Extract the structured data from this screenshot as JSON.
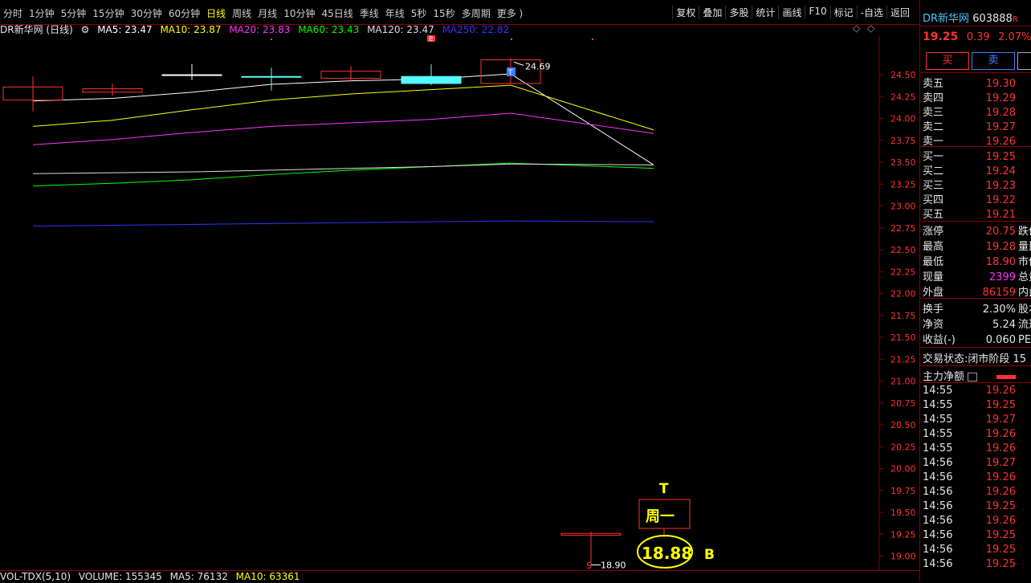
{
  "toolbar": {
    "tabs": [
      "分时",
      "1分钟",
      "5分钟",
      "15分钟",
      "30分钟",
      "60分钟",
      "日线",
      "周线",
      "月线",
      "10分钟",
      "45日线",
      "季线",
      "年线",
      "5秒",
      "15秒",
      "多周期",
      "更多 )"
    ],
    "active_tab": "日线",
    "right_buttons": [
      "复权",
      "叠加",
      "多股",
      "统计",
      "画线",
      "F10",
      "标记",
      "-自选",
      "返回"
    ]
  },
  "chart_header": {
    "name": "DR新华网 (日线)",
    "ma5": "MA5: 23.47",
    "ma10": "MA10: 23.87",
    "ma20": "MA20: 23.83",
    "ma60": "MA60: 23.43",
    "ma120": "MA120: 23.47",
    "ma250": "MA250: 22.82"
  },
  "colors": {
    "ma5": "#ffffff",
    "ma10": "#ffff00",
    "ma20": "#ff33ff",
    "ma60": "#00ff00",
    "ma120": "#dddddd",
    "ma250": "#3333ff",
    "up": "#ff3333",
    "down": "#54ffff",
    "grid": "#8a0000"
  },
  "chart_data": {
    "type": "candlestick",
    "yticks": [
      "24.50",
      "24.25",
      "24.00",
      "23.75",
      "23.50",
      "23.25",
      "23.00",
      "22.75",
      "22.50",
      "22.25",
      "22.00",
      "21.75",
      "21.50",
      "21.25",
      "21.00",
      "20.75",
      "20.50",
      "20.25",
      "20.00",
      "19.75",
      "19.50",
      "19.25",
      "19.00"
    ],
    "ylim": [
      18.84,
      24.95
    ],
    "candles": [
      {
        "open": 24.21,
        "close": 24.36,
        "high": 24.48,
        "low": 24.08,
        "color": "up"
      },
      {
        "open": 24.3,
        "close": 24.34,
        "high": 24.4,
        "low": 24.26,
        "color": "up"
      },
      {
        "open": 24.5,
        "close": 24.5,
        "high": 24.62,
        "low": 24.44,
        "color": "flat"
      },
      {
        "open": 24.48,
        "close": 24.48,
        "high": 24.58,
        "low": 24.32,
        "color": "down"
      },
      {
        "open": 24.46,
        "close": 24.54,
        "high": 24.6,
        "low": 24.42,
        "color": "up"
      },
      {
        "open": 24.48,
        "close": 24.4,
        "high": 24.62,
        "low": 24.38,
        "color": "down"
      },
      {
        "open": 24.4,
        "close": 24.67,
        "high": 24.69,
        "low": 24.4,
        "color": "up"
      },
      {
        "open": 19.26,
        "close": 19.24,
        "high": 19.28,
        "low": 18.9,
        "color": "up"
      }
    ],
    "ma_lines": {
      "ma5": [
        24.2,
        24.23,
        24.3,
        24.39,
        24.43,
        24.45,
        24.51,
        23.47
      ],
      "ma10": [
        23.91,
        23.98,
        24.1,
        24.21,
        24.28,
        24.33,
        24.38,
        23.87
      ],
      "ma20": [
        23.7,
        23.76,
        23.84,
        23.91,
        23.95,
        23.99,
        24.06,
        23.83
      ],
      "ma60": [
        23.23,
        23.26,
        23.3,
        23.36,
        23.41,
        23.45,
        23.49,
        23.43
      ],
      "ma120": [
        23.37,
        23.38,
        23.39,
        23.41,
        23.43,
        23.45,
        23.48,
        23.47
      ],
      "ma250": [
        22.77,
        22.78,
        22.79,
        22.8,
        22.81,
        22.82,
        22.83,
        22.82
      ]
    },
    "labels": {
      "high": "24.69",
      "low": "18.90",
      "b_mark": "B",
      "t_mark": "T",
      "s_mark": "S"
    }
  },
  "annotation": {
    "t": "T",
    "weekday": "周一",
    "price": "18.88",
    "b": "B"
  },
  "volume_header": {
    "name": "VOL-TDX(5,10)",
    "volume": "VOLUME: 155345",
    "ma5": "MA5: 76132",
    "ma10": "MA10: 63361"
  },
  "side": {
    "name": "DR新华网",
    "code": "603888",
    "flag": "R",
    "price": "19.25",
    "change": "0.39",
    "pct": "2.07%",
    "buy_label": "买",
    "sell_label": "卖",
    "asks": [
      [
        "卖五",
        "19.30"
      ],
      [
        "卖四",
        "19.29"
      ],
      [
        "卖三",
        "19.28"
      ],
      [
        "卖二",
        "19.27"
      ],
      [
        "卖一",
        "19.26"
      ]
    ],
    "bids": [
      [
        "买一",
        "19.25"
      ],
      [
        "买二",
        "19.24"
      ],
      [
        "买三",
        "19.23"
      ],
      [
        "买四",
        "19.22"
      ],
      [
        "买五",
        "19.21"
      ]
    ],
    "stats": [
      [
        "涨停",
        "20.75",
        "跌停"
      ],
      [
        "最高",
        "19.28",
        "量比"
      ],
      [
        "最低",
        "18.90",
        "市值"
      ],
      [
        "现量",
        "2399",
        "总量"
      ],
      [
        "外盘",
        "86159",
        "内盘"
      ]
    ],
    "stats2": [
      [
        "换手",
        "2.30%",
        "股本"
      ],
      [
        "净资",
        "5.24",
        "流通"
      ],
      [
        "收益(-)",
        "0.060",
        "PE"
      ]
    ],
    "status_label": "交易状态:",
    "status_value": "闭市阶段 15",
    "netflow_label": "主力净额",
    "ticks": [
      [
        "14:55",
        "19.26"
      ],
      [
        "14:55",
        "19.25"
      ],
      [
        "14:55",
        "19.27"
      ],
      [
        "14:55",
        "19.26"
      ],
      [
        "14:55",
        "19.26"
      ],
      [
        "14:56",
        "19.27"
      ],
      [
        "14:56",
        "19.26"
      ],
      [
        "14:56",
        "19.26"
      ],
      [
        "14:56",
        "19.25"
      ],
      [
        "14:56",
        "19.26"
      ],
      [
        "14:56",
        "19.25"
      ],
      [
        "14:56",
        "19.25"
      ],
      [
        "14:56",
        "19.25"
      ]
    ]
  }
}
